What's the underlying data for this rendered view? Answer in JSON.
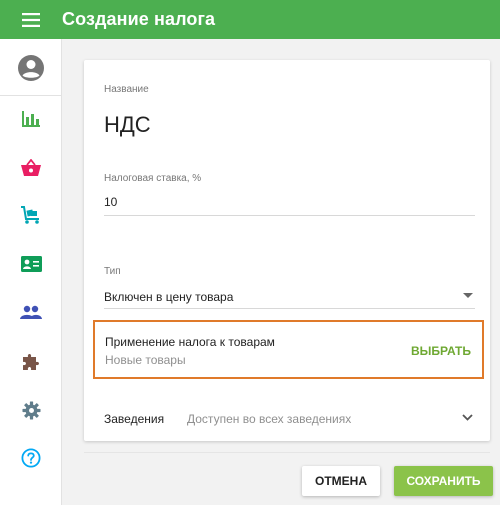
{
  "header": {
    "title": "Создание налога",
    "menu_icon": "hamburger-menu-icon",
    "color": "#4caf50"
  },
  "sidebar": {
    "items": [
      {
        "name": "account-icon",
        "color": "#757575"
      },
      {
        "name": "analytics-icon",
        "color": "#4caf50"
      },
      {
        "name": "basket-icon",
        "color": "#e91e63"
      },
      {
        "name": "warehouse-cart-icon",
        "color": "#00a6b4"
      },
      {
        "name": "contact-card-icon",
        "color": "#0f9d58"
      },
      {
        "name": "people-icon",
        "color": "#3f51b5"
      },
      {
        "name": "puzzle-icon",
        "color": "#795548"
      },
      {
        "name": "settings-icon",
        "color": "#607d8b"
      },
      {
        "name": "help-icon",
        "color": "#03a9f4"
      }
    ]
  },
  "form": {
    "name_label": "Название",
    "name_value": "НДС",
    "rate_label": "Налоговая ставка, %",
    "rate_value": "10",
    "type_label": "Тип",
    "type_value": "Включен в цену товара",
    "apply_title": "Применение налога к товарам",
    "apply_subtitle": "Новые товары",
    "apply_action": "ВЫБРАТЬ",
    "venues_label": "Заведения",
    "venues_value": "Доступен во всех заведениях"
  },
  "footer": {
    "cancel_label": "ОТМЕНА",
    "save_label": "СОХРАНИТЬ"
  },
  "colors": {
    "highlight_border": "#e07a2a",
    "action_green": "#6ea832",
    "save_button": "#8bc34a"
  }
}
